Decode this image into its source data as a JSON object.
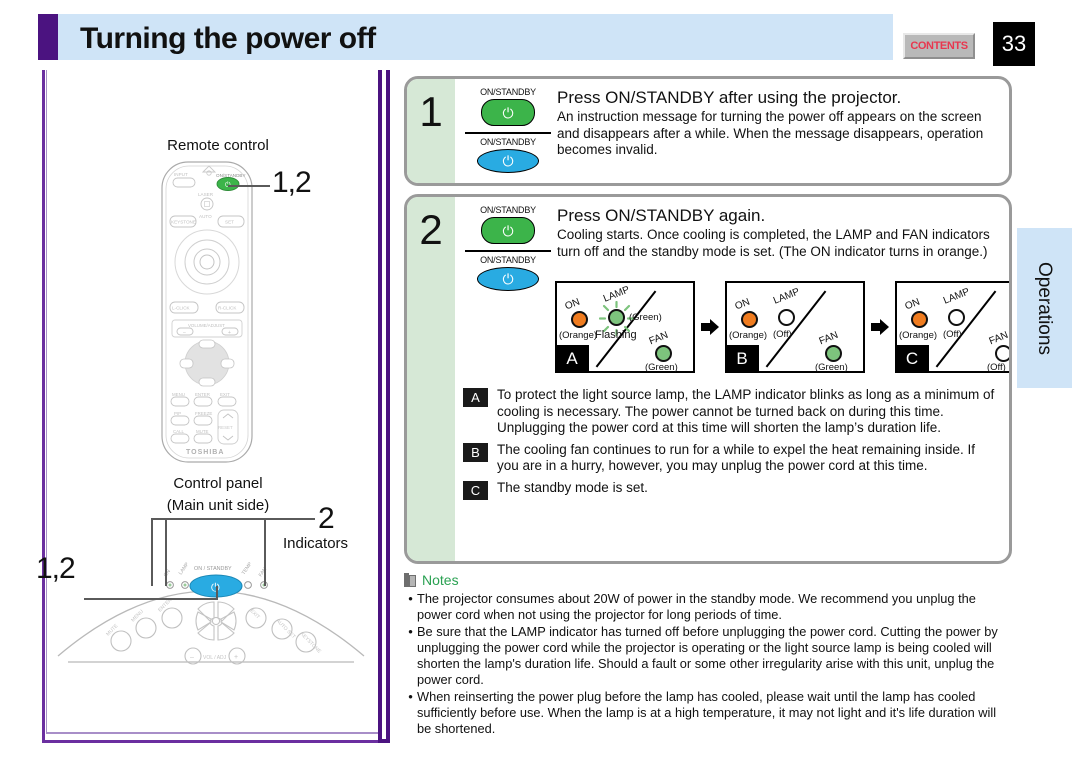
{
  "header": {
    "title": "Turning the power off",
    "contents_button": "CONTENTS",
    "page_number": "33",
    "side_tab": "Operations"
  },
  "left_panel": {
    "remote_label": "Remote control",
    "remote_callout": "1,2",
    "control_panel_label": "Control panel",
    "control_panel_sublabel": "(Main unit side)",
    "indicators_callout": "2",
    "indicators_label": "Indicators",
    "power_callout": "1,2",
    "remote_keys": {
      "input": "INPUT",
      "on_standby": "ON/STANDBY",
      "laser": "LASER",
      "keystone": "KEYSTONE",
      "auto": "AUTO",
      "set": "SET",
      "l_click": "L-CLICK",
      "r_click": "R-CLICK",
      "volume": "VOLUME/ADJUST",
      "minus": "–",
      "plus": "+",
      "menu": "MENU",
      "enter": "ENTER",
      "exit": "EXIT",
      "pip": "PIP",
      "freeze": "FREEZE",
      "call": "CALL",
      "mute": "MUTE",
      "reset": "RESET",
      "brand": "TOSHIBA"
    },
    "panel_keys": {
      "on": "ON",
      "lamp": "LAMP",
      "on_standby": "ON / STANDBY",
      "temp": "TEMP",
      "fan": "FAN",
      "mute": "MUTE",
      "menu": "MENU",
      "enter": "ENTER",
      "exit": "EXIT",
      "auto_set": "AUTO SET",
      "keystone": "KEYSTONE",
      "volume": "VOL / ADJ",
      "minus": "–",
      "plus": "+"
    }
  },
  "steps": [
    {
      "number": "1",
      "key_caption_top": "ON/STANDBY",
      "key_caption_bottom": "ON/STANDBY",
      "heading": "Press ON/STANDBY after using the projector.",
      "body": "An instruction message for turning the power off appears on the screen and disappears after a while. When the message disappears, operation becomes invalid."
    },
    {
      "number": "2",
      "key_caption_top": "ON/STANDBY",
      "key_caption_bottom": "ON/STANDBY",
      "heading": "Press ON/STANDBY again.",
      "body": "Cooling starts. Once cooling is completed, the LAMP and FAN indicators turn off and the standby mode is set. (The ON indicator turns in orange.)"
    }
  ],
  "diagrams": [
    {
      "tag": "A",
      "on_label": "ON",
      "on_state": "(Orange)",
      "lamp_label": "LAMP",
      "lamp_state": "(Green)",
      "lamp_note": "Flashing",
      "fan_label": "FAN",
      "fan_state": "(Green)"
    },
    {
      "tag": "B",
      "on_label": "ON",
      "on_state": "(Orange)",
      "lamp_label": "LAMP",
      "lamp_state": "(Off)",
      "lamp_note": "",
      "fan_label": "FAN",
      "fan_state": "(Green)"
    },
    {
      "tag": "C",
      "on_label": "ON",
      "on_state": "(Orange)",
      "lamp_label": "LAMP",
      "lamp_state": "(Off)",
      "lamp_note": "",
      "fan_label": "FAN",
      "fan_state": "(Off)"
    }
  ],
  "abc_notes": [
    {
      "tag": "A",
      "text": "To protect the light source lamp, the LAMP indicator blinks as long as a minimum of cooling is necessary. The power cannot be turned back on during this time. Unplugging the power cord at this time will shorten the lamp’s duration life."
    },
    {
      "tag": "B",
      "text": "The cooling fan continues to run for a while to expel the heat remaining inside. If you are in a hurry, however, you may unplug the power cord at this time."
    },
    {
      "tag": "C",
      "text": "The standby mode is set."
    }
  ],
  "notes": {
    "title": "Notes",
    "bullet": "•",
    "items": [
      "The projector consumes about 20W of power in the standby mode. We recommend you unplug the power cord when not using the projector for long periods of time.",
      "Be sure that the LAMP indicator has turned off before unplugging the power cord. Cutting the power by unplugging the power cord while the projector is operating or the light source lamp is being cooled will shorten the lamp's duration life. Should a fault or some other irregularity arise with this unit, unplug the power cord.",
      "When reinserting the power plug before the lamp has cooled, please wait until the lamp has cooled sufficiently before use. When the lamp is at a high temperature, it may not light and it's life duration will be shortened."
    ]
  },
  "colors": {
    "header_bg": "#cfe4f7",
    "accent_purple": "#4b1380",
    "step_num_bg": "#d6e8d6",
    "green_key": "#3cb44a",
    "blue_key": "#29abe2",
    "orange_led": "#f07c1f",
    "green_led": "#7dc47d",
    "notes_green": "#2aa152",
    "contents_red": "#e8374f"
  }
}
